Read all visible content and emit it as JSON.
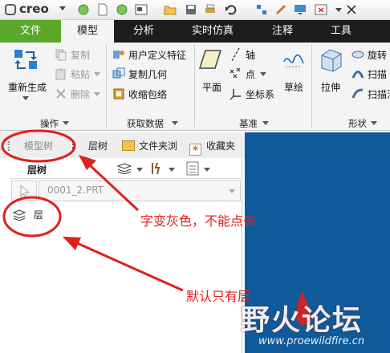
{
  "app": {
    "name": "creo"
  },
  "tabs": [
    {
      "label": "文件"
    },
    {
      "label": "模型"
    },
    {
      "label": "分析"
    },
    {
      "label": "实时仿真"
    },
    {
      "label": "注释"
    },
    {
      "label": "工具"
    }
  ],
  "ribbon": {
    "regenerate": "重新生成",
    "copy": "复制",
    "paste": "粘贴",
    "delete": "删除",
    "udf": "用户定义特征",
    "copy_geom": "复制几何",
    "shrinkwrap": "收缩包络",
    "plane": "平面",
    "axis": "轴",
    "point": "点",
    "csys": "坐标系",
    "sketch": "草绘",
    "extrude": "拉伸",
    "revolve": "旋转",
    "sweep": "扫描",
    "sweep_blend": "扫描混",
    "groups": {
      "operations": "操作",
      "get_data": "获取数据",
      "datum": "基准",
      "shapes": "形状"
    }
  },
  "panel": {
    "tabs": [
      {
        "label": "模型树"
      },
      {
        "label": "层树"
      },
      {
        "label": "文件夹浏"
      },
      {
        "label": "收藏夹"
      }
    ],
    "header": "层树",
    "model_select": "0001_2.PRT",
    "tree_item": "层"
  },
  "annotations": {
    "greyed": "字变灰色，不能点击",
    "default_only": "默认只有层"
  },
  "watermark": {
    "title": "野火论坛",
    "url": "www.proewildfire.cn"
  },
  "colors": {
    "file_tab": "#5aa82a",
    "tab_bar": "#1d1d1d",
    "annotation": "#e0201c",
    "graphics_bg": "#0f5a9a"
  }
}
